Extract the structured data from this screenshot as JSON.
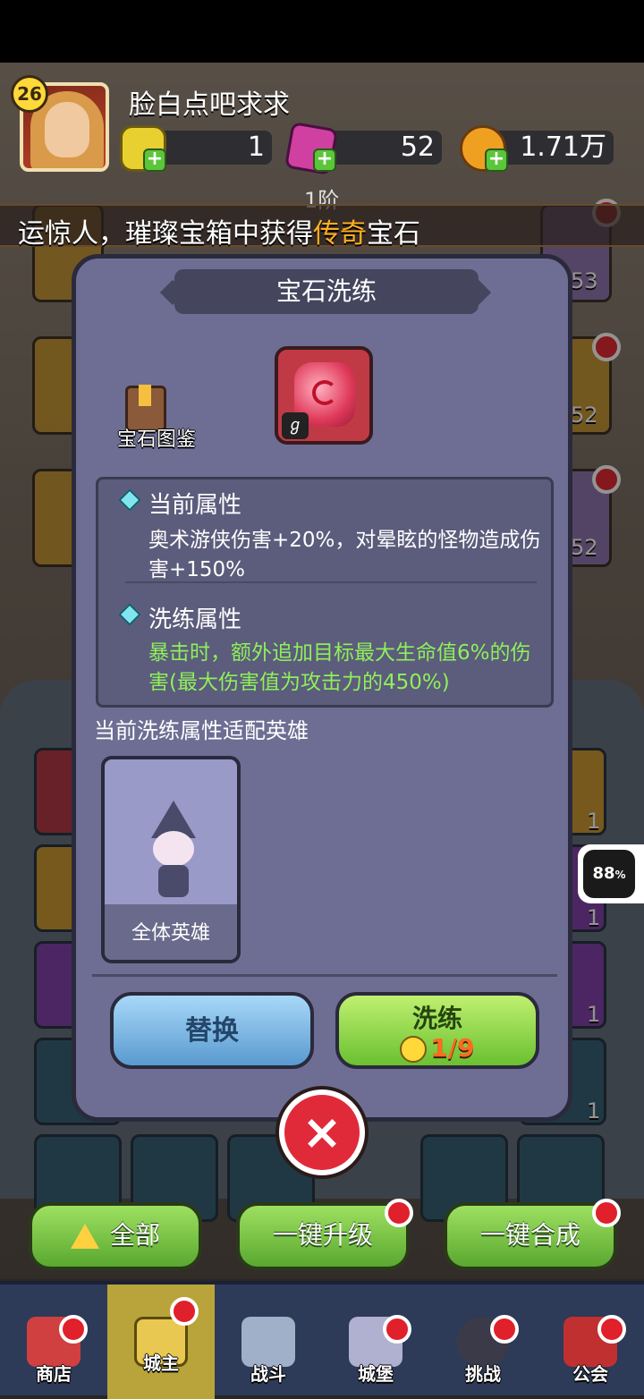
{
  "header": {
    "level": "26",
    "player_name": "脸白点吧求求",
    "resources": [
      {
        "icon": "yellow-gem-icon",
        "value": "1"
      },
      {
        "icon": "pink-crystal-icon",
        "value": "52"
      },
      {
        "icon": "gold-coin-icon",
        "value": "1.71万"
      }
    ],
    "tier": "1阶"
  },
  "marquee": {
    "prefix": "运惊人，璀璨宝箱中获得",
    "highlight": "传奇",
    "suffix": "宝石"
  },
  "side_counts": {
    "right_1": "53",
    "right_2": "52",
    "right_3": "52"
  },
  "lower_counts": [
    "1",
    "1",
    "1",
    "1"
  ],
  "modal": {
    "title": "宝石洗练",
    "book_label": "宝石图鉴",
    "current_attr_title": "当前属性",
    "current_attr_text": "奥术游侠伤害+20%，对晕眩的怪物造成伤害+150%",
    "refine_attr_title": "洗练属性",
    "refine_attr_text": "暴击时，额外追加目标最大生命值6%的伤害(最大伤害值为攻击力的450%)",
    "hero_section_label": "当前洗练属性适配英雄",
    "hero_label": "全体英雄",
    "replace_button": "替换",
    "refine_button": "洗练",
    "refine_cost": "1/9",
    "close_icon": "×"
  },
  "floating_badge": {
    "value": "88",
    "unit": "%"
  },
  "actions": {
    "all": "全部",
    "upgrade": "一键升级",
    "merge": "一键合成"
  },
  "nav": {
    "items": [
      {
        "label": "商店",
        "icon": "shop-icon"
      },
      {
        "label": "城主",
        "icon": "crown-icon"
      },
      {
        "label": "战斗",
        "icon": "swords-icon"
      },
      {
        "label": "城堡",
        "icon": "castle-icon"
      },
      {
        "label": "挑战",
        "icon": "demon-icon"
      },
      {
        "label": "公会",
        "icon": "guild-book-icon"
      }
    ],
    "active_index": 1
  },
  "colors": {
    "accent_green": "#8ef05a",
    "legendary_orange": "#ffb020",
    "modal_bg": "#6e6e94",
    "notify_red": "#e0202a"
  }
}
